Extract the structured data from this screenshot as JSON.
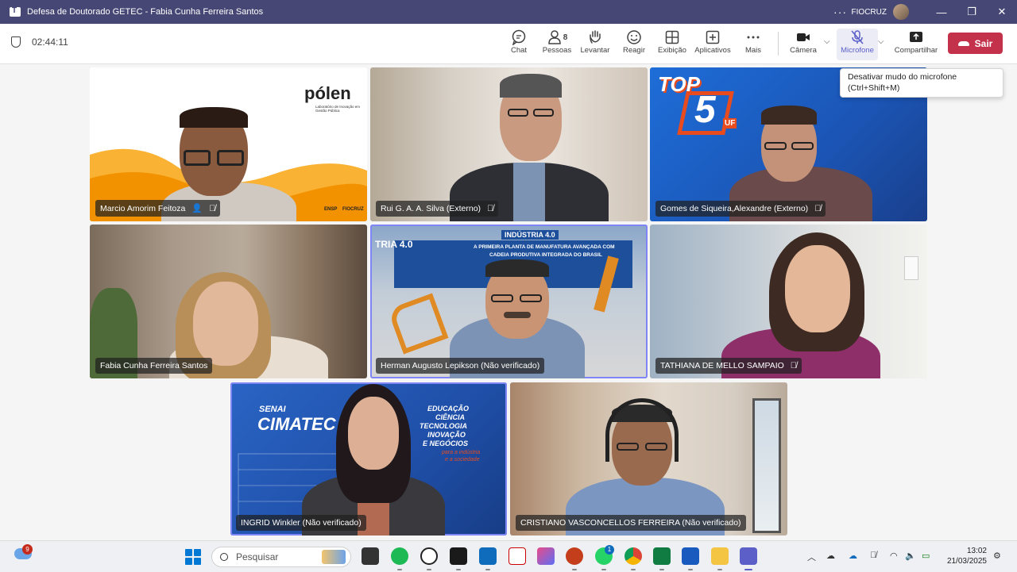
{
  "window": {
    "title": "Defesa de Doutorado GETEC - Fabia Cunha Ferreira Santos",
    "more": "···",
    "org": "FIOCRUZ",
    "minimize": "—",
    "restore": "❐",
    "close": "✕"
  },
  "toolbar": {
    "timer": "02:44:11",
    "buttons": [
      {
        "label": "Chat",
        "icon": "chat-icon"
      },
      {
        "label": "Pessoas",
        "icon": "people-icon",
        "count": "8"
      },
      {
        "label": "Levantar",
        "icon": "raise-hand-icon"
      },
      {
        "label": "Reagir",
        "icon": "react-icon"
      },
      {
        "label": "Exibição",
        "icon": "view-icon"
      },
      {
        "label": "Aplicativos",
        "icon": "apps-icon"
      },
      {
        "label": "Mais",
        "icon": "more-icon"
      },
      {
        "label": "Câmera",
        "icon": "camera-icon"
      },
      {
        "label": "Microfone",
        "icon": "mic-muted-icon"
      },
      {
        "label": "Compartilhar",
        "icon": "share-icon"
      }
    ],
    "leave": "Sair"
  },
  "tooltip": {
    "line1": "Desativar mudo do microfone",
    "line2": "(Ctrl+Shift+M)"
  },
  "tiles": [
    {
      "name": "Marcio Amorim Feitoza",
      "brand": "pólen",
      "brand_sub": "Laboratório de Inovação em Gestão Pública",
      "logo1": "ENSP",
      "logo2": "FIOCRUZ"
    },
    {
      "name": "Rui G. A. A. Silva (Externo)"
    },
    {
      "name": "Gomes de Siqueira,Alexandre (Externo)",
      "bg_text1": "TOP",
      "bg_text2": "5",
      "bg_text3": "UF"
    },
    {
      "name": "Fabia Cunha Ferreira Santos"
    },
    {
      "name": "Herman Augusto Lepikson (Não verificado)",
      "bg_text1": "INDÚSTRIA 4.0",
      "bg_text2": "TRIA 4.0",
      "bg_text3": "A PRIMEIRA PLANTA DE MANUFATURA AVANÇADA COM",
      "bg_text4": "CADEIA PRODUTIVA INTEGRADA DO BRASIL"
    },
    {
      "name": "TATHIANA DE MELLO SAMPAIO"
    },
    {
      "name": "INGRID Winkler (Não verificado)",
      "bg_text1": "SENAI",
      "bg_text2": "CIMATEC",
      "bg_text3": "EDUCAÇÃO",
      "bg_text4": "CIÊNCIA",
      "bg_text5": "TECNOLOGIA",
      "bg_text6": "INOVAÇÃO",
      "bg_text7": "E NEGÓCIOS",
      "bg_text8": "para a indústria",
      "bg_text9": "e a sociedade"
    },
    {
      "name": "CRISTIANO VASCONCELLOS FERREIRA (Não verificado)"
    }
  ],
  "taskbar": {
    "weather_badge": "9",
    "search_placeholder": "Pesquisar",
    "whatsapp_badge": "1",
    "time": "13:02",
    "date": "21/03/2025"
  }
}
